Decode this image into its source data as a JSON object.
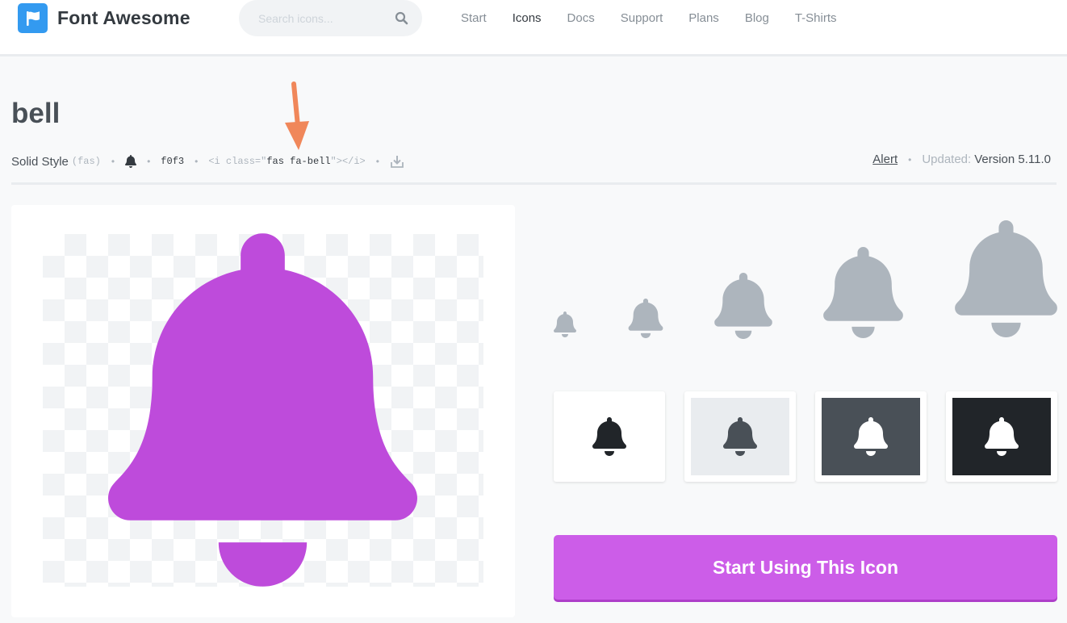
{
  "header": {
    "logo_text": "Font Awesome",
    "search_placeholder": "Search icons...",
    "nav": [
      "Start",
      "Icons",
      "Docs",
      "Support",
      "Plans",
      "Blog",
      "T-Shirts"
    ],
    "active_nav": "Icons"
  },
  "icon": {
    "name": "bell",
    "style_label": "Solid Style",
    "style_short": "(fas)",
    "unicode": "f0f3",
    "code_prefix": "<i class=\"",
    "code_class": "fas fa-bell",
    "code_suffix": "\"></i>",
    "category_link": "Alert",
    "updated_label": "Updated:",
    "version": "Version 5.11.0",
    "preview_color": "#be4bdb"
  },
  "sizes_icon_color": "#adb5bd",
  "swatches": [
    {
      "bg": "#ffffff",
      "fg": "#212529"
    },
    {
      "bg": "#e9ecef",
      "fg": "#495057"
    },
    {
      "bg": "#495057",
      "fg": "#ffffff"
    },
    {
      "bg": "#212529",
      "fg": "#ffffff"
    }
  ],
  "cta": {
    "label": "Start Using This Icon",
    "color": "#cc5de8"
  }
}
